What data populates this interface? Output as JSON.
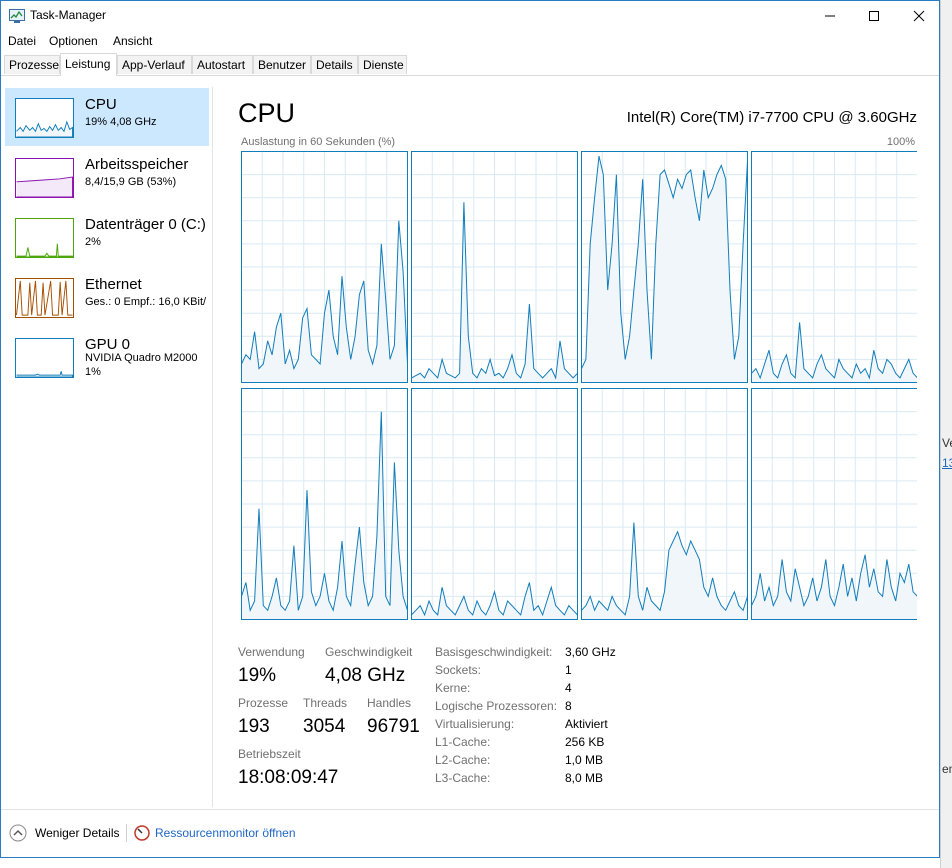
{
  "window": {
    "title": "Task-Manager"
  },
  "menu": [
    "Datei",
    "Optionen",
    "Ansicht"
  ],
  "tabs": [
    "Prozesse",
    "Leistung",
    "App-Verlauf",
    "Autostart",
    "Benutzer",
    "Details",
    "Dienste"
  ],
  "active_tab": "Leistung",
  "sidebar": {
    "items": [
      {
        "name": "CPU",
        "line1": "19%  4,08 GHz",
        "color": "#117dbb"
      },
      {
        "name": "Arbeitsspeicher",
        "line1": "8,4/15,9 GB (53%)",
        "color": "#8b12ae"
      },
      {
        "name": "Datenträger 0 (C:)",
        "line1": "2%",
        "color": "#4da60c"
      },
      {
        "name": "Ethernet",
        "line1": "Ges.: 0  Empf.: 16,0 KBit/",
        "color": "#a74f01"
      },
      {
        "name": "GPU 0",
        "line1": "NVIDIA Quadro M2000",
        "line2": "1%",
        "color": "#117dbb"
      }
    ]
  },
  "main": {
    "title": "CPU",
    "cpu_model": "Intel(R) Core(TM) i7-7700 CPU @ 3.60GHz",
    "chart_label": "Auslastung in 60 Sekunden (%)",
    "chart_max": "100%"
  },
  "stats": {
    "usage_label": "Verwendung",
    "usage": "19%",
    "speed_label": "Geschwindigkeit",
    "speed": "4,08 GHz",
    "processes_label": "Prozesse",
    "processes": "193",
    "threads_label": "Threads",
    "threads": "3054",
    "handles_label": "Handles",
    "handles": "96791",
    "uptime_label": "Betriebszeit",
    "uptime": "18:08:09:47"
  },
  "info": [
    {
      "label": "Basisgeschwindigkeit:",
      "value": "3,60 GHz"
    },
    {
      "label": "Sockets:",
      "value": "1"
    },
    {
      "label": "Kerne:",
      "value": "4"
    },
    {
      "label": "Logische Prozessoren:",
      "value": "8"
    },
    {
      "label": "Virtualisierung:",
      "value": "Aktiviert"
    },
    {
      "label": "L1-Cache:",
      "value": "256 KB"
    },
    {
      "label": "L2-Cache:",
      "value": "1,0 MB"
    },
    {
      "label": "L3-Cache:",
      "value": "8,0 MB"
    }
  ],
  "footer": {
    "less_details": "Weniger Details",
    "resource_monitor": "Ressourcenmonitor öffnen"
  },
  "background_window": {
    "text1": "Ve",
    "text2": "13",
    "text3": "en"
  },
  "colors": {
    "accent": "#117dbb",
    "selection": "#cce8ff",
    "link": "#1f66c4"
  },
  "chart_data": {
    "type": "area",
    "ylim": [
      0,
      100
    ],
    "series": [
      {
        "values": [
          8,
          12,
          10,
          22,
          6,
          8,
          18,
          12,
          24,
          30,
          8,
          14,
          6,
          10,
          28,
          32,
          12,
          10,
          8,
          30,
          40,
          20,
          12,
          46,
          24,
          10,
          20,
          38,
          44,
          14,
          8,
          16,
          60,
          36,
          10,
          16,
          70,
          48,
          8
        ]
      },
      {
        "values": [
          2,
          3,
          4,
          2,
          6,
          4,
          2,
          10,
          4,
          3,
          2,
          4,
          78,
          20,
          4,
          2,
          6,
          4,
          10,
          3,
          4,
          2,
          6,
          12,
          4,
          2,
          8,
          34,
          6,
          4,
          2,
          4,
          6,
          2,
          18,
          6,
          4,
          2,
          4
        ]
      },
      {
        "values": [
          6,
          10,
          60,
          80,
          98,
          90,
          40,
          60,
          90,
          30,
          10,
          20,
          40,
          60,
          88,
          40,
          10,
          60,
          90,
          92,
          86,
          80,
          88,
          84,
          90,
          92,
          80,
          70,
          92,
          80,
          84,
          90,
          94,
          88,
          40,
          10,
          20,
          60,
          96
        ]
      },
      {
        "values": [
          4,
          6,
          2,
          8,
          14,
          4,
          2,
          8,
          12,
          4,
          2,
          26,
          6,
          4,
          2,
          8,
          12,
          6,
          4,
          2,
          10,
          6,
          4,
          2,
          8,
          4,
          6,
          2,
          14,
          6,
          4,
          10,
          8,
          4,
          2,
          6,
          10,
          4,
          2
        ]
      },
      {
        "values": [
          10,
          16,
          4,
          8,
          48,
          6,
          4,
          10,
          18,
          6,
          4,
          8,
          32,
          4,
          10,
          56,
          12,
          6,
          10,
          20,
          8,
          4,
          14,
          34,
          10,
          6,
          24,
          40,
          16,
          6,
          10,
          36,
          90,
          10,
          6,
          68,
          30,
          10,
          4
        ]
      },
      {
        "values": [
          2,
          4,
          6,
          2,
          8,
          4,
          2,
          14,
          6,
          4,
          2,
          6,
          10,
          4,
          2,
          8,
          4,
          2,
          6,
          12,
          4,
          2,
          8,
          6,
          4,
          2,
          10,
          16,
          4,
          6,
          2,
          8,
          14,
          6,
          4,
          2,
          6,
          4,
          2
        ]
      },
      {
        "values": [
          4,
          6,
          10,
          4,
          8,
          6,
          4,
          10,
          6,
          4,
          2,
          10,
          42,
          10,
          4,
          14,
          8,
          6,
          4,
          12,
          30,
          34,
          38,
          32,
          28,
          34,
          30,
          26,
          14,
          10,
          18,
          10,
          6,
          4,
          8,
          12,
          6,
          4,
          10
        ]
      },
      {
        "values": [
          6,
          10,
          20,
          8,
          14,
          6,
          10,
          26,
          12,
          8,
          22,
          14,
          6,
          10,
          18,
          8,
          14,
          26,
          10,
          6,
          14,
          24,
          10,
          18,
          8,
          20,
          28,
          14,
          22,
          12,
          10,
          26,
          14,
          8,
          20,
          16,
          24,
          12,
          10
        ]
      }
    ]
  }
}
